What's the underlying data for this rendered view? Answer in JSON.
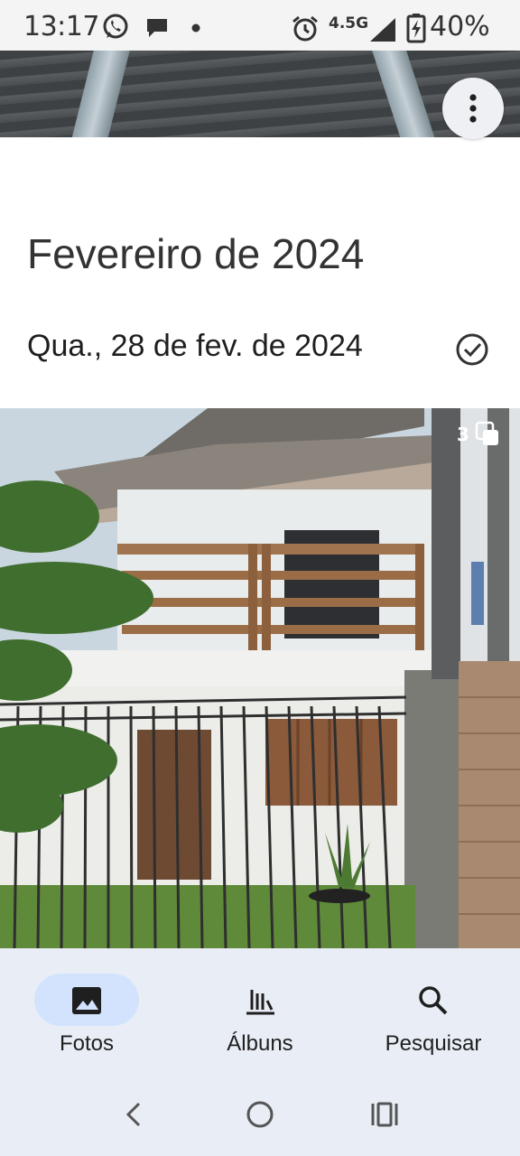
{
  "status_bar": {
    "time": "13:17",
    "network": "4.5G",
    "battery": "40%",
    "left_icons": [
      "whatsapp-icon",
      "chat-bubble-icon",
      "dot-icon"
    ],
    "right_icons": [
      "alarm-icon",
      "signal-icon",
      "battery-charging-icon"
    ]
  },
  "top_bar": {
    "menu_icon": "more-vert-icon"
  },
  "gallery": {
    "month_heading": "Fevereiro de 2024",
    "day_heading": "Qua., 28 de fev. de 2024",
    "select_icon": "check-circle-icon",
    "photo": {
      "stack_count": "3",
      "stack_icon": "burst-stack-icon"
    }
  },
  "bottom_nav": {
    "items": [
      {
        "label": "Fotos",
        "icon": "photo-icon",
        "selected": true
      },
      {
        "label": "Álbuns",
        "icon": "library-icon",
        "selected": false
      },
      {
        "label": "Pesquisar",
        "icon": "search-icon",
        "selected": false
      }
    ]
  },
  "system_nav": {
    "buttons": [
      "back-icon",
      "home-icon",
      "recents-icon"
    ]
  },
  "colors": {
    "nav_background": "#e9eef6",
    "nav_selected_pill": "#d3e3fd",
    "text_primary": "#1f1f1f"
  }
}
